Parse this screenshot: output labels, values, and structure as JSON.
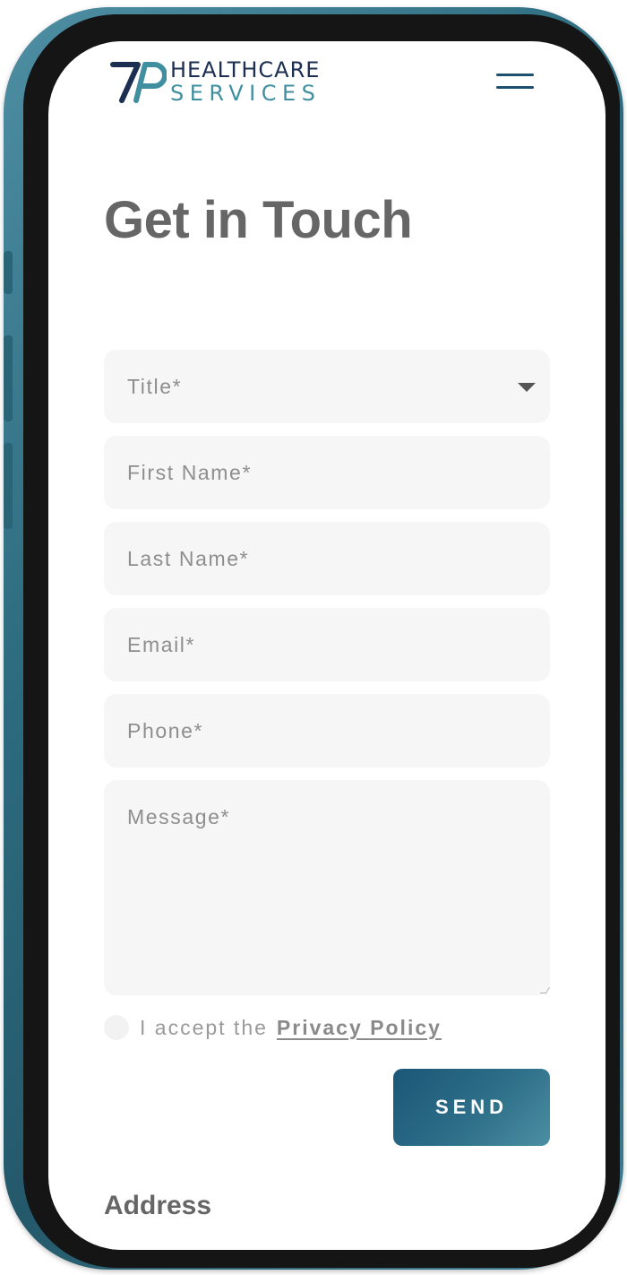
{
  "brand": {
    "line1": "HEALTHCARE",
    "line2": "SERVICES",
    "mark": "7P",
    "dark_color": "#1c2f52",
    "accent_color": "#3f8fa0"
  },
  "header": {
    "menu_icon": "hamburger-menu-icon"
  },
  "main": {
    "title": "Get in Touch",
    "form": {
      "title_select": {
        "placeholder": "Title*",
        "icon": "chevron-down-icon"
      },
      "first_name": {
        "placeholder": "First Name*"
      },
      "last_name": {
        "placeholder": "Last Name*"
      },
      "email": {
        "placeholder": "Email*"
      },
      "phone": {
        "placeholder": "Phone*"
      },
      "message": {
        "placeholder": "Message*"
      },
      "consent": {
        "prefix": "I accept the",
        "link": "Privacy Policy"
      },
      "submit_label": "SEND"
    },
    "address_heading": "Address"
  },
  "colors": {
    "button_gradient_start": "#1b5676",
    "button_gradient_end": "#4c8fa2",
    "field_background": "#f6f6f6",
    "heading": "#666666"
  }
}
